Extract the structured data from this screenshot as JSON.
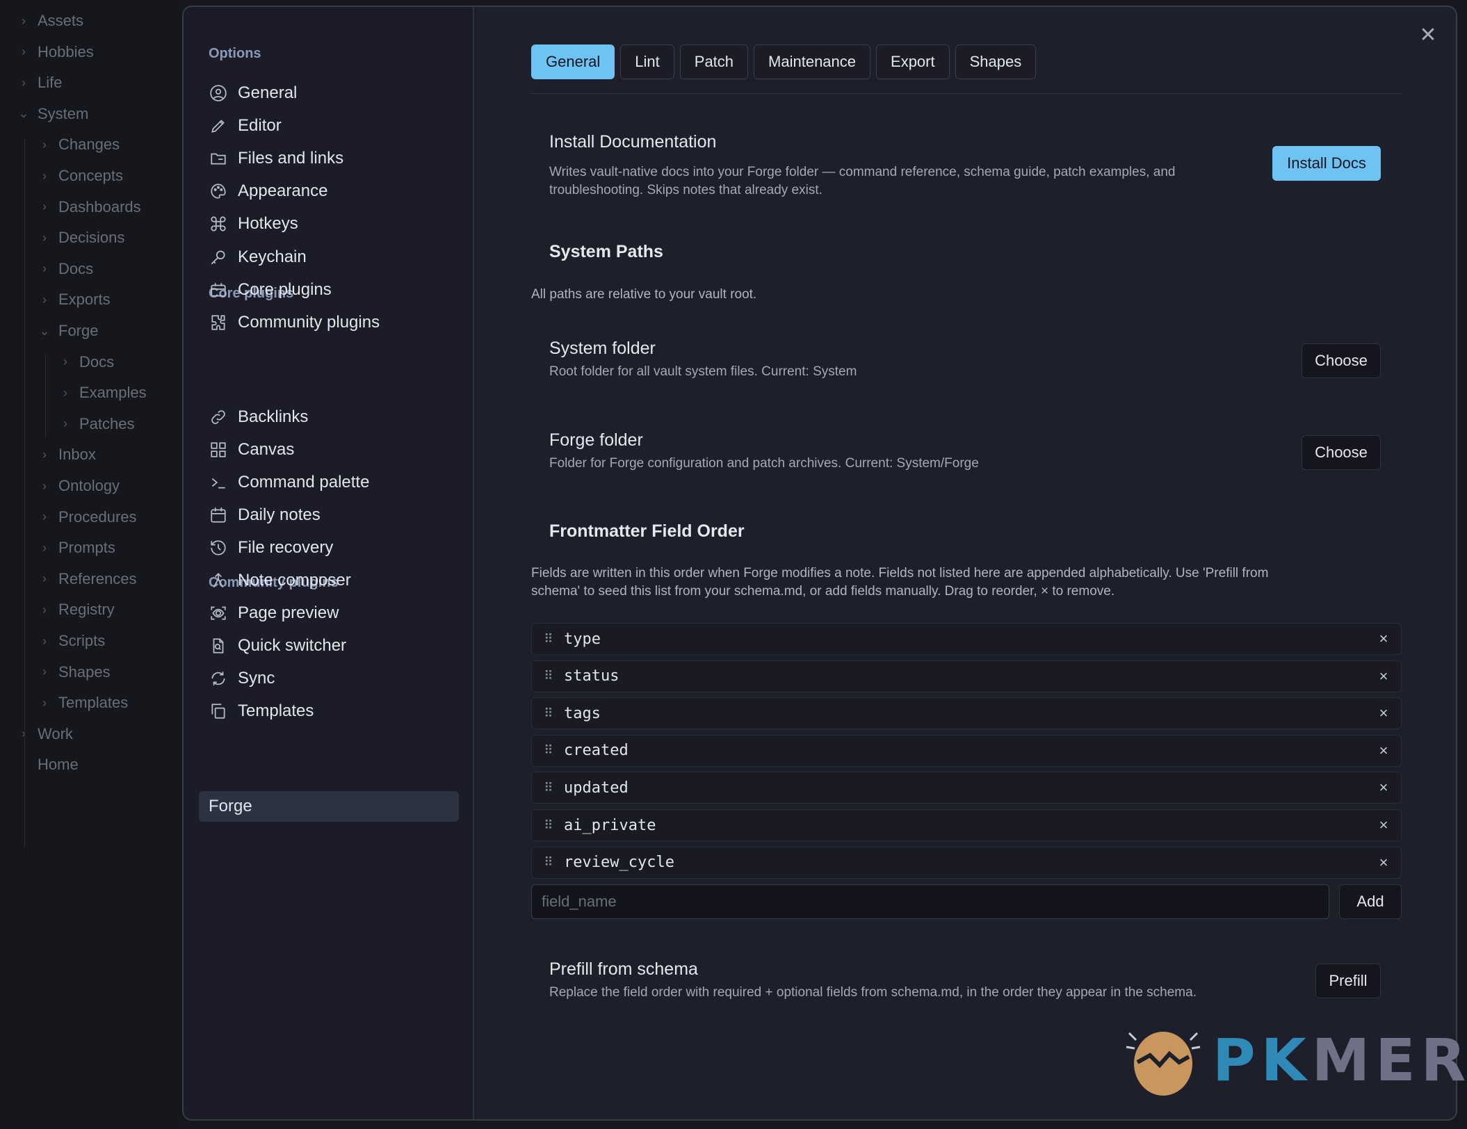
{
  "file_tree": {
    "items": [
      {
        "label": "Assets",
        "expanded": false,
        "depth": 0
      },
      {
        "label": "Hobbies",
        "expanded": false,
        "depth": 0
      },
      {
        "label": "Life",
        "expanded": false,
        "depth": 0
      },
      {
        "label": "System",
        "expanded": true,
        "depth": 0
      },
      {
        "label": "Changes",
        "expanded": false,
        "depth": 1
      },
      {
        "label": "Concepts",
        "expanded": false,
        "depth": 1
      },
      {
        "label": "Dashboards",
        "expanded": false,
        "depth": 1
      },
      {
        "label": "Decisions",
        "expanded": false,
        "depth": 1
      },
      {
        "label": "Docs",
        "expanded": false,
        "depth": 1
      },
      {
        "label": "Exports",
        "expanded": false,
        "depth": 1
      },
      {
        "label": "Forge",
        "expanded": true,
        "depth": 1
      },
      {
        "label": "Docs",
        "expanded": false,
        "depth": 2
      },
      {
        "label": "Examples",
        "expanded": false,
        "depth": 2
      },
      {
        "label": "Patches",
        "expanded": false,
        "depth": 2
      },
      {
        "label": "Inbox",
        "expanded": false,
        "depth": 1
      },
      {
        "label": "Ontology",
        "expanded": false,
        "depth": 1
      },
      {
        "label": "Procedures",
        "expanded": false,
        "depth": 1
      },
      {
        "label": "Prompts",
        "expanded": false,
        "depth": 1
      },
      {
        "label": "References",
        "expanded": false,
        "depth": 1
      },
      {
        "label": "Registry",
        "expanded": false,
        "depth": 1
      },
      {
        "label": "Scripts",
        "expanded": false,
        "depth": 1
      },
      {
        "label": "Shapes",
        "expanded": false,
        "depth": 1
      },
      {
        "label": "Templates",
        "expanded": false,
        "depth": 1
      },
      {
        "label": "Work",
        "expanded": false,
        "depth": 0
      },
      {
        "label": "Home",
        "expanded": null,
        "depth": 0
      }
    ]
  },
  "settings_sidebar": {
    "options_heading": "Options",
    "options": [
      {
        "label": "General",
        "icon": "user-circle-icon"
      },
      {
        "label": "Editor",
        "icon": "pencil-icon"
      },
      {
        "label": "Files and links",
        "icon": "folder-icon"
      },
      {
        "label": "Appearance",
        "icon": "palette-icon"
      },
      {
        "label": "Hotkeys",
        "icon": "command-icon"
      },
      {
        "label": "Keychain",
        "icon": "key-icon"
      },
      {
        "label": "Core plugins",
        "icon": "calendar-box-icon"
      },
      {
        "label": "Community plugins",
        "icon": "puzzle-icon"
      }
    ],
    "core_heading": "Core plugins",
    "core": [
      {
        "label": "Backlinks",
        "icon": "backlinks-icon"
      },
      {
        "label": "Canvas",
        "icon": "grid-icon"
      },
      {
        "label": "Command palette",
        "icon": "terminal-icon"
      },
      {
        "label": "Daily notes",
        "icon": "calendar-icon"
      },
      {
        "label": "File recovery",
        "icon": "history-icon"
      },
      {
        "label": "Note composer",
        "icon": "merge-icon"
      },
      {
        "label": "Page preview",
        "icon": "preview-icon"
      },
      {
        "label": "Quick switcher",
        "icon": "file-search-icon"
      },
      {
        "label": "Sync",
        "icon": "sync-icon"
      },
      {
        "label": "Templates",
        "icon": "copy-icon"
      }
    ],
    "community_heading": "Community plugins",
    "community": [
      {
        "label": "Forge",
        "active": true
      }
    ]
  },
  "tabs": [
    {
      "label": "General",
      "active": true
    },
    {
      "label": "Lint",
      "active": false
    },
    {
      "label": "Patch",
      "active": false
    },
    {
      "label": "Maintenance",
      "active": false
    },
    {
      "label": "Export",
      "active": false
    },
    {
      "label": "Shapes",
      "active": false
    }
  ],
  "install_docs": {
    "title": "Install Documentation",
    "desc_line1": "Writes vault-native docs into your Forge folder — command reference, schema guide, patch examples, and",
    "desc_line2": "troubleshooting. Skips notes that already exist.",
    "button": "Install Docs"
  },
  "system_paths": {
    "heading": "System Paths",
    "note": "All paths are relative to your vault root.",
    "system_folder": {
      "title": "System folder",
      "desc": "Root folder for all vault system files. Current: System",
      "button": "Choose"
    },
    "forge_folder": {
      "title": "Forge folder",
      "desc": "Folder for Forge configuration and patch archives. Current: System/Forge",
      "button": "Choose"
    }
  },
  "frontmatter": {
    "heading": "Frontmatter Field Order",
    "desc_line1": "Fields are written in this order when Forge modifies a note. Fields not listed here are appended alphabetically. Use 'Prefill from",
    "desc_line2": "schema' to seed this list from your schema.md, or add fields manually. Drag to reorder, × to remove.",
    "fields": [
      "type",
      "status",
      "tags",
      "created",
      "updated",
      "ai_private",
      "review_cycle"
    ],
    "remove_glyph": "×",
    "grip_glyph": "⠿",
    "input_placeholder": "field_name",
    "add_button": "Add"
  },
  "prefill": {
    "title": "Prefill from schema",
    "desc": "Replace the field order with required + optional fields from schema.md, in the order they appear in the schema.",
    "button": "Prefill"
  },
  "close_glyph": "✕",
  "watermark": {
    "text": "PKMER",
    "colors": {
      "p_k": "#2f8ab8",
      "m_e_r": "#6f7286",
      "egg": "#c9975d"
    }
  },
  "colors": {
    "accent": "#6ec3f2",
    "modal_bg": "#1d1f2a",
    "sidebar_bg": "#1b1c27",
    "active_item_bg": "#2d3243"
  }
}
